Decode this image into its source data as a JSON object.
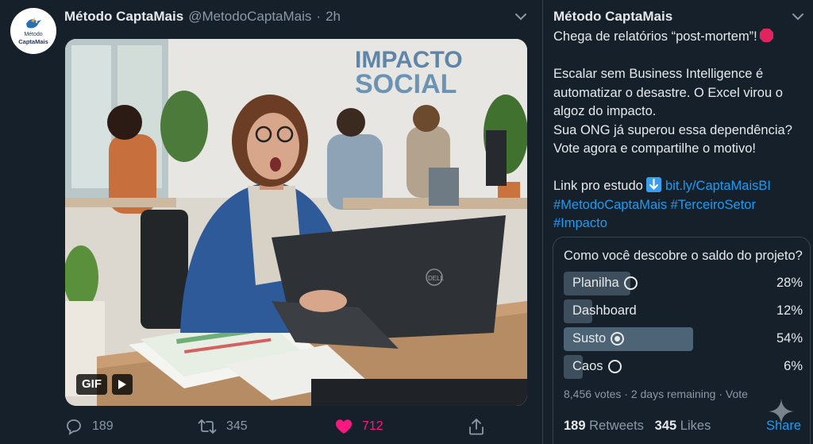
{
  "tweet": {
    "author_name": "Método CaptaMais",
    "handle": "@MetodoCaptaMais",
    "separator": "·",
    "time": "2h",
    "avatar": {
      "line1": "Método",
      "line2": "CaptaMais"
    },
    "media": {
      "sign_line1": "IMPACTO",
      "sign_line2": "SOCIAL",
      "laptop_brand": "DELL",
      "gif_label": "GIF"
    },
    "actions": {
      "replies": "189",
      "retweets": "345",
      "likes": "712"
    }
  },
  "detail": {
    "author_name": "Método CaptaMais",
    "body": {
      "line1": "Chega de relatórios “post-mortem”!",
      "line2": "Escalar sem Business Intelligence é",
      "line3": "automatizar o desastre. O Excel virou o",
      "line4": "algoz do impacto.",
      "line5": "Sua ONG já superou essa dependência?",
      "line6": "Vote agora e compartilhe o motivo!",
      "link_prefix": "Link pro estudo",
      "link": "bit.ly/CaptaMaisBI",
      "hashtag1": "#MetodoCaptaMais",
      "hashtag2": "#TerceiroSetor",
      "hashtag3": "#Impacto"
    },
    "poll": {
      "question": "Como você descobre o saldo do projeto?",
      "options": [
        {
          "label": "Planilha",
          "percent": "28%",
          "fraction": 0.28,
          "selected": false
        },
        {
          "label": "Dashboard",
          "percent": "12%",
          "fraction": 0.12,
          "selected": false
        },
        {
          "label": "Susto",
          "percent": "54%",
          "fraction": 0.54,
          "selected": true
        },
        {
          "label": "Caos",
          "percent": "6%",
          "fraction": 0.06,
          "selected": false
        }
      ],
      "meta": "8,456 votes · 2 days remaining · Vote"
    },
    "stats": {
      "retweets_count": "189",
      "retweets_label": "Retweets",
      "likes_count": "345",
      "likes_label": "Likes"
    },
    "share_label": "Share"
  },
  "colors": {
    "background": "#15202b",
    "accent": "#1d9bf0",
    "like": "#f91880",
    "muted": "#8b98a5"
  },
  "icons": {
    "reply": "reply-icon",
    "retweet": "retweet-icon",
    "like": "heart-icon",
    "share": "share-icon",
    "more": "chevron-down-icon",
    "stop": "stop-sign-emoji",
    "down": "down-arrow-emoji",
    "sparkle": "sparkle-icon"
  }
}
